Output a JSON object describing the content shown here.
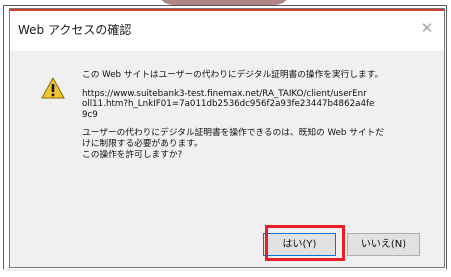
{
  "dialog": {
    "title": "Web アクセスの確認",
    "close_glyph": "✕",
    "message_line1": "この Web サイトはユーザーの代わりにデジタル証明書の操作を実行します。",
    "url": "https://www.suitebank3-test.finemax.net/RA_TAIKO/client/userEnr\noll11.htm?h_LnkIF01=7a011db2536dc956f2a93fe23447b4862a4fe\n9c9",
    "message_line2": "ユーザーの代わりにデジタル証明書を操作できるのは、既知の Web サイトだ\nけに制限する必要があります。\nこの操作を許可しますか?",
    "yes_label": "はい(Y)",
    "no_label": "いいえ(N)"
  },
  "icons": {
    "warning": "warning-icon",
    "close": "close-icon"
  },
  "colors": {
    "accent": "#d23b2f",
    "highlight": "#ea1f28",
    "warning_fill": "#f2c530",
    "dialog_bg": "#f0f0f0"
  }
}
